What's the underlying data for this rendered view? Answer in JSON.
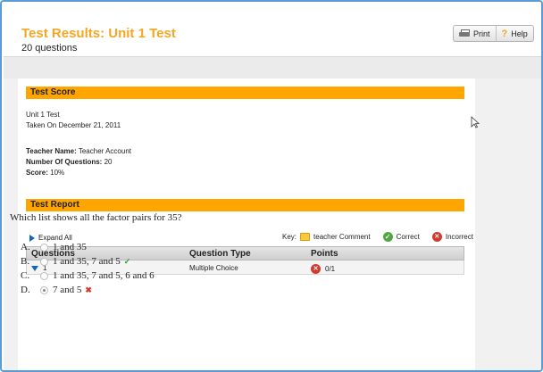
{
  "header": {
    "title": "Test Results: Unit 1 Test",
    "subtitle": "20 questions",
    "print_label": "Print",
    "help_label": "Help"
  },
  "test_score": {
    "section_title": "Test Score",
    "test_name": "Unit 1 Test",
    "taken_on": "Taken On December 21, 2011",
    "teacher_label": "Teacher Name:",
    "teacher_value": "Teacher Account",
    "num_questions_label": "Number Of Questions:",
    "num_questions_value": "20",
    "score_label": "Score:",
    "score_value": "10%"
  },
  "test_report": {
    "section_title": "Test Report",
    "expand_all": "Expand All",
    "key_label": "Key:",
    "key_comment": "teacher Comment",
    "key_correct": "Correct",
    "key_incorrect": "Incorrect",
    "columns": [
      "Questions",
      "Question Type",
      "Points"
    ],
    "rows": [
      {
        "number": "1",
        "type": "Multiple Choice",
        "points": "0/1"
      }
    ]
  },
  "question": {
    "text": "Which list shows all the factor pairs for 35?",
    "options": [
      {
        "letter": "A.",
        "text": "1 and 35",
        "selected": false,
        "mark": ""
      },
      {
        "letter": "B.",
        "text": "1 and 35, 7 and 5",
        "selected": false,
        "mark": "✓"
      },
      {
        "letter": "C.",
        "text": "1 and 35, 7 and 5, 6 and 6",
        "selected": false,
        "mark": ""
      },
      {
        "letter": "D.",
        "text": "7 and 5",
        "selected": true,
        "mark": "✖"
      }
    ]
  },
  "colors": {
    "accent_orange": "#f5a623",
    "section_bar": "#ffa500",
    "correct": "#4fa83d",
    "incorrect": "#d13b2f"
  }
}
